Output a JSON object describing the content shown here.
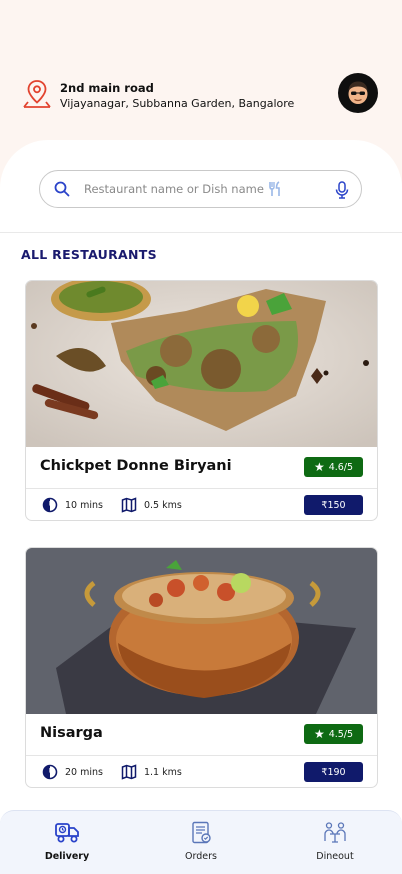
{
  "header": {
    "address_line1": "2nd main road",
    "address_line2": "Vijayanagar, Subbanna Garden, Bangalore"
  },
  "search": {
    "placeholder": "Restaurant name or Dish name"
  },
  "section_title": "ALL RESTAURANTS",
  "restaurants": [
    {
      "name": "Chickpet Donne Biryani",
      "rating": "4.6/5",
      "time": "10 mins",
      "distance": "0.5 kms",
      "price": "₹150"
    },
    {
      "name": "Nisarga",
      "rating": "4.5/5",
      "time": "20 mins",
      "distance": "1.1 kms",
      "price": "₹190"
    }
  ],
  "bottom_nav": [
    {
      "label": "Delivery",
      "icon": "delivery-truck-icon",
      "active": true
    },
    {
      "label": "Orders",
      "icon": "orders-receipt-icon",
      "active": false
    },
    {
      "label": "Dineout",
      "icon": "dineout-table-icon",
      "active": false
    }
  ],
  "colors": {
    "rating_bg": "#0e6a13",
    "price_bg": "#101a6b",
    "accent_blue": "#2a43c9",
    "pin_red": "#e2432f",
    "section_title": "#1a1a6e"
  }
}
